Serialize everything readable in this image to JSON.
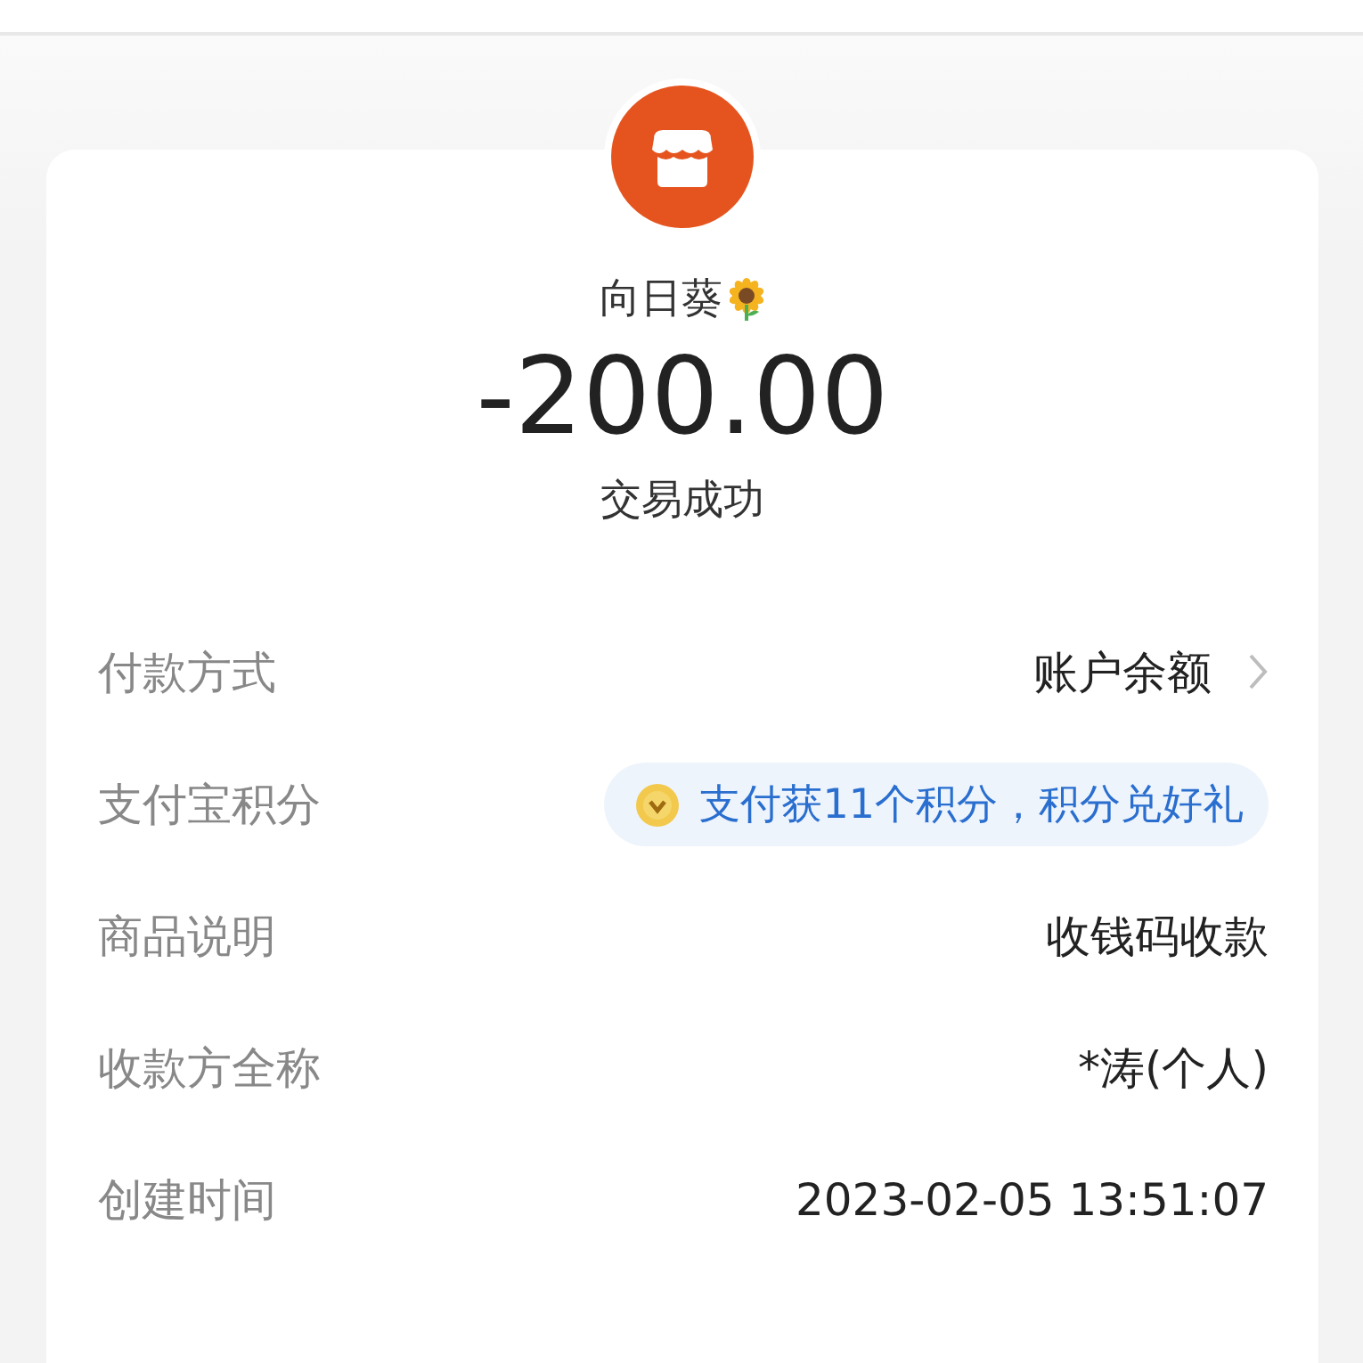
{
  "merchant": {
    "name": "向日葵"
  },
  "amount": "-200.00",
  "status": "交易成功",
  "rows": [
    {
      "label": "付款方式",
      "kind": "link",
      "value": "账户余额"
    },
    {
      "label": "支付宝积分",
      "kind": "badge",
      "value": "支付获11个积分，积分兑好礼"
    },
    {
      "label": "商品说明",
      "kind": "text",
      "value": "收钱码收款"
    },
    {
      "label": "收款方全称",
      "kind": "text",
      "value": "*涛(个人)"
    },
    {
      "label": "创建时间",
      "kind": "text",
      "value": "2023-02-05 13:51:07"
    }
  ]
}
